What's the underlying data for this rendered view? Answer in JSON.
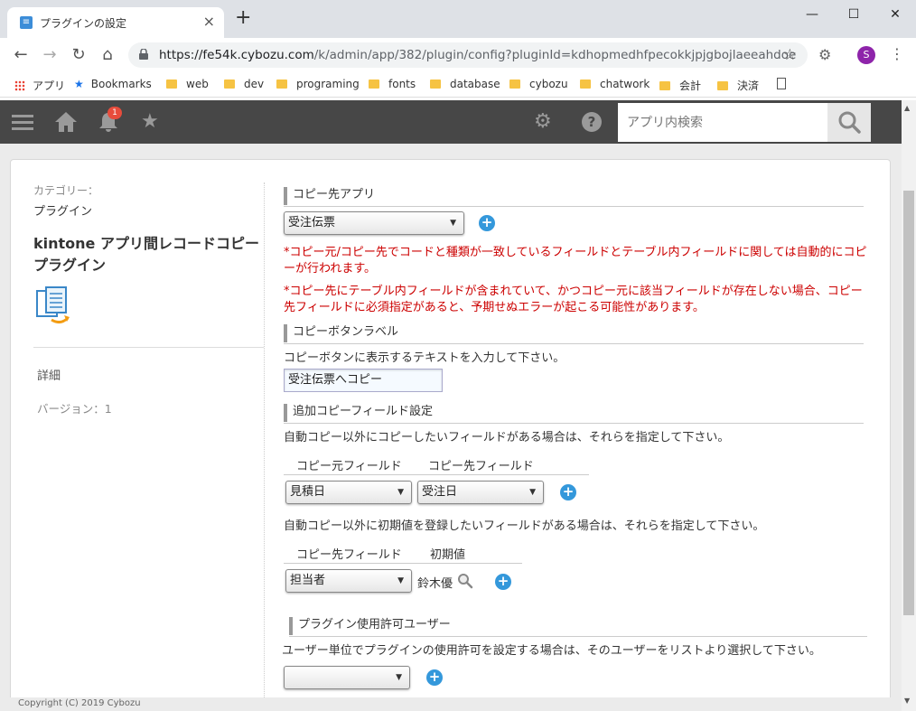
{
  "browser": {
    "tab_title": "プラグインの設定",
    "url_host": "https://fe54k.cybozu.com",
    "url_path": "/k/admin/app/382/plugin/config?pluginId=kdhopmedhfpecokkjpjgbojlaeeahdoe",
    "avatar_letter": "S",
    "bookmarks": [
      "アプリ",
      "Bookmarks",
      "web",
      "dev",
      "programing",
      "fonts",
      "database",
      "cybozu",
      "chatwork",
      "会計",
      "決済"
    ]
  },
  "header": {
    "notification_count": "1",
    "search_placeholder": "アプリ内検索"
  },
  "sidebar": {
    "category_label": "カテゴリー：",
    "category_value": "プラグイン",
    "plugin_name": "kintone アプリ間レコードコピープラグイン",
    "detail_label": "詳細",
    "version_label": "バージョン：1"
  },
  "sections": {
    "target_app": {
      "title": "コピー先アプリ",
      "selected": "受注伝票",
      "warning1": "*コピー元/コピー先でコードと種類が一致しているフィールドとテーブル内フィールドに関しては自動的にコピーが行われます。",
      "warning2": "*コピー先にテーブル内フィールドが含まれていて、かつコピー元に該当フィールドが存在しない場合、コピー先フィールドに必須指定があると、予期せぬエラーが起こる可能性があります。"
    },
    "button_label": {
      "title": "コピーボタンラベル",
      "description": "コピーボタンに表示するテキストを入力して下さい。",
      "value": "受注伝票へコピー"
    },
    "extra_fields": {
      "title": "追加コピーフィールド設定",
      "description1": "自動コピー以外にコピーしたいフィールドがある場合は、それらを指定して下さい。",
      "col_source": "コピー元フィールド",
      "col_target": "コピー先フィールド",
      "source_selected": "見積日",
      "target_selected": "受注日",
      "description2": "自動コピー以外に初期値を登録したいフィールドがある場合は、それらを指定して下さい。",
      "col_target2": "コピー先フィールド",
      "col_initial": "初期値",
      "target2_selected": "担当者",
      "initial_value": "鈴木優"
    },
    "permission": {
      "title": "プラグイン使用許可ユーザー",
      "description": "ユーザー単位でプラグインの使用許可を設定する場合は、そのユーザーをリストより選択して下さい。",
      "selected": ""
    }
  },
  "footer": {
    "copyright": "Copyright (C) 2019 Cybozu"
  }
}
